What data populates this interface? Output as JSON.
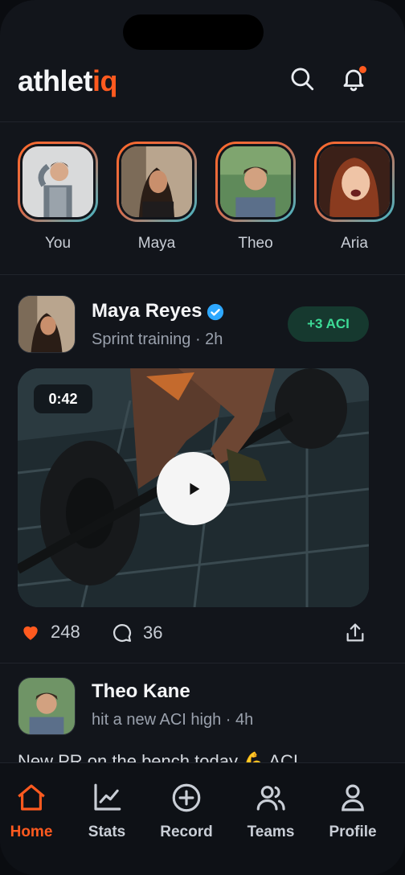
{
  "app": {
    "logo_main": "athlet",
    "logo_accent": "iq",
    "accent_color": "#ff5a1f",
    "header_icons": [
      "search-icon",
      "bell-icon"
    ]
  },
  "stories": [
    {
      "label": "You"
    },
    {
      "label": "Maya"
    },
    {
      "label": "Theo"
    },
    {
      "label": "Aria"
    }
  ],
  "posts": [
    {
      "author": "Maya Reyes",
      "verified": true,
      "subtitle": "Sprint training · 2h",
      "badge": "+3 ACI",
      "duration": "0:42",
      "likes": "248",
      "comments": "36"
    },
    {
      "author": "Theo Kane",
      "subtitle": "hit a new ACI high · 4h",
      "caption": "New PR on the bench today 💪 ACI"
    }
  ],
  "tabs": [
    {
      "label": "Home",
      "icon": "home-icon",
      "active": true
    },
    {
      "label": "Stats",
      "icon": "chart-icon"
    },
    {
      "label": "Record",
      "icon": "plus-circle-icon"
    },
    {
      "label": "Teams",
      "icon": "users-icon"
    },
    {
      "label": "Profile",
      "icon": "user-icon"
    }
  ]
}
